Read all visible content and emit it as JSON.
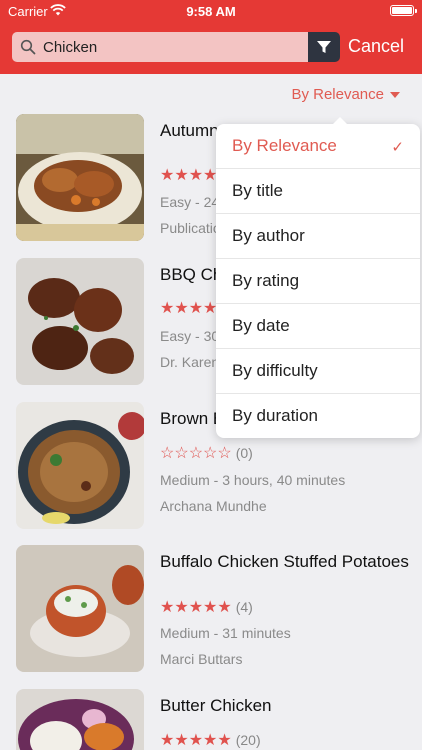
{
  "status": {
    "carrier": "Carrier",
    "time": "9:58 AM"
  },
  "search": {
    "value": "Chicken",
    "cancel_label": "Cancel"
  },
  "sort": {
    "current_label": "By Relevance",
    "options": [
      {
        "label": "By Relevance",
        "selected": true
      },
      {
        "label": "By title",
        "selected": false
      },
      {
        "label": "By author",
        "selected": false
      },
      {
        "label": "By rating",
        "selected": false
      },
      {
        "label": "By date",
        "selected": false
      },
      {
        "label": "By difficulty",
        "selected": false
      },
      {
        "label": "By duration",
        "selected": false
      }
    ],
    "check_glyph": "✓"
  },
  "recipes": [
    {
      "title": "Autumn Chicken and Vegetables",
      "stars": "★★★★",
      "count": "",
      "meta": "Easy - 24",
      "author": "Publications"
    },
    {
      "title": "BBQ Ch",
      "stars": "★★★★",
      "count": "",
      "meta": "Easy - 30",
      "author": "Dr. Karen"
    },
    {
      "title": "Brown B",
      "stars": "☆☆☆☆☆",
      "count": "(0)",
      "meta": "Medium - 3 hours, 40 minutes",
      "author": "Archana Mundhe"
    },
    {
      "title": "Buffalo Chicken Stuffed Potatoes",
      "stars": "★★★★★",
      "count": "(4)",
      "meta": "Medium - 31 minutes",
      "author": "Marci Buttars"
    },
    {
      "title": "Butter Chicken",
      "stars": "★★★★★",
      "count": "(20)",
      "meta": "",
      "author": ""
    }
  ],
  "colors": {
    "brand_red": "#e53935",
    "accent": "#e05b52",
    "filter_button": "#2e3440"
  }
}
